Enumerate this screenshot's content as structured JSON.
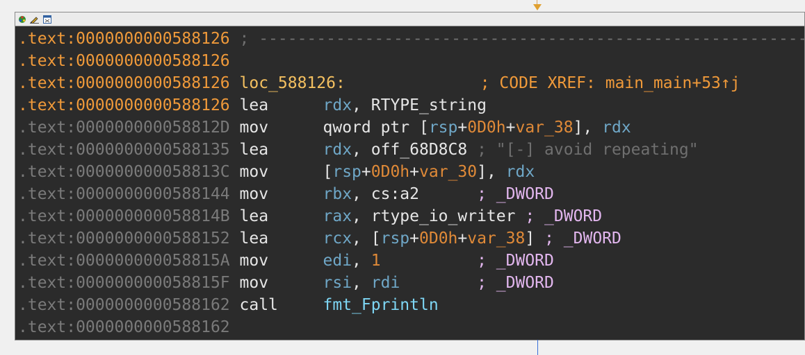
{
  "header": {
    "icons": [
      "graph-icon",
      "edit-icon",
      "window-icon"
    ]
  },
  "lines": [
    {
      "addr": ".text:0000000000588126",
      "addr_active": true,
      "separator": "; ------------------------------------------------------------"
    },
    {
      "addr": ".text:0000000000588126",
      "addr_active": true
    },
    {
      "addr": ".text:0000000000588126",
      "addr_active": true,
      "label": "loc_588126:",
      "xref": "; CODE XREF: main_main+53↑j"
    },
    {
      "addr": ".text:0000000000588126",
      "addr_active": true,
      "mnemonic": "lea",
      "op_reg": "rdx",
      "op_rest": "RTYPE_string"
    },
    {
      "addr": ".text:000000000058812D",
      "mnemonic": "mov",
      "text_a": "qword ptr [",
      "reg1": "rsp",
      "num": "0D0h",
      "var": "var_38",
      "text_b": "], ",
      "reg2": "rdx"
    },
    {
      "addr": ".text:0000000000588135",
      "mnemonic": "lea",
      "op_reg": "rdx",
      "op_rest": "off_68D8C8",
      "comment": "; \"[-] avoid repeating\""
    },
    {
      "addr": ".text:000000000058813C",
      "mnemonic": "mov",
      "text_a": "[",
      "reg1": "rsp",
      "num": "0D0h",
      "var": "var_30",
      "text_b": "], ",
      "reg2": "rdx"
    },
    {
      "addr": ".text:0000000000588144",
      "mnemonic": "mov",
      "op_reg": "rbx",
      "op_rest": "cs:a2",
      "type_comment": "; _DWORD"
    },
    {
      "addr": ".text:000000000058814B",
      "mnemonic": "lea",
      "op_reg": "rax",
      "op_rest": "rtype_io_writer",
      "type_comment": "; _DWORD"
    },
    {
      "addr": ".text:0000000000588152",
      "mnemonic": "lea",
      "op_reg": "rcx",
      "text_a": "[",
      "reg1": "rsp",
      "num": "0D0h",
      "var": "var_38",
      "text_b": "]",
      "type_comment": "; _DWORD"
    },
    {
      "addr": ".text:000000000058815A",
      "mnemonic": "mov",
      "op_reg": "edi",
      "op_num": "1",
      "type_comment": "; _DWORD"
    },
    {
      "addr": ".text:000000000058815F",
      "mnemonic": "mov",
      "op_reg": "rsi",
      "op_reg2": "rdi",
      "type_comment": "; _DWORD"
    },
    {
      "addr": ".text:0000000000588162",
      "mnemonic": "call",
      "call_target": "fmt_Fprintln"
    },
    {
      "addr": ".text:0000000000588162"
    }
  ]
}
